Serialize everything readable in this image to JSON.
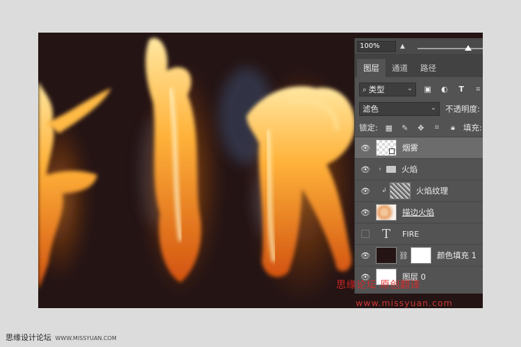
{
  "panel": {
    "zoom": "100%",
    "tabs": [
      "图层",
      "通道",
      "路径"
    ],
    "filter": {
      "label": "类型"
    },
    "blend": {
      "mode": "滤色",
      "opacity_label": "不透明度:"
    },
    "lock": {
      "label": "锁定:",
      "fill_label": "填充:"
    },
    "layers": [
      {
        "name": "烟雾",
        "kind": "smart",
        "visible": true,
        "selected": true
      },
      {
        "name": "火焰",
        "kind": "group",
        "visible": true
      },
      {
        "name": "火焰纹理",
        "kind": "clipped",
        "visible": true
      },
      {
        "name": "描边火焰",
        "kind": "raster",
        "visible": true
      },
      {
        "name": "FIRE",
        "kind": "text",
        "visible": false
      },
      {
        "name": "颜色填充 1",
        "kind": "fill",
        "visible": true
      },
      {
        "name": "图层 0",
        "kind": "raster",
        "visible": true
      }
    ]
  },
  "watermarks": {
    "overlay": "思缘论坛 原创翻译",
    "url": "www.missyuan.com",
    "site_name": "思缘设计论坛",
    "site_url": "WWW.MISSYUAN.COM"
  },
  "canvas": {
    "letters": [
      "F",
      "I",
      "R"
    ],
    "background": "#241414"
  }
}
